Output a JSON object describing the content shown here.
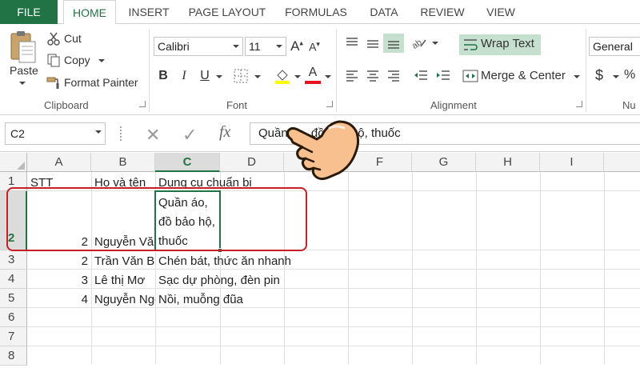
{
  "tabs": [
    {
      "label": "FILE"
    },
    {
      "label": "HOME"
    },
    {
      "label": "INSERT"
    },
    {
      "label": "PAGE LAYOUT"
    },
    {
      "label": "FORMULAS"
    },
    {
      "label": "DATA"
    },
    {
      "label": "REVIEW"
    },
    {
      "label": "VIEW"
    }
  ],
  "clipboard": {
    "paste": "Paste",
    "cut": "Cut",
    "copy": "Copy",
    "format_painter": "Format Painter",
    "group": "Clipboard"
  },
  "font": {
    "name": "Calibri",
    "size": "11",
    "bold": "B",
    "italic": "I",
    "underline": "U",
    "font_color_letter": "A",
    "group": "Font"
  },
  "alignment": {
    "wrap_text": "Wrap Text",
    "merge_center": "Merge & Center",
    "group": "Alignment"
  },
  "number": {
    "format": "General",
    "currency": "$",
    "percent": "%",
    "group": "Nu"
  },
  "formula_bar": {
    "name_box": "C2",
    "fx": "fx",
    "content": "Quần áo, đồ bảo hộ, thuốc"
  },
  "columns": [
    "A",
    "B",
    "C",
    "D",
    "E",
    "F",
    "G",
    "H",
    "I"
  ],
  "rows": [
    "1",
    "2",
    "3",
    "4",
    "5",
    "6",
    "7",
    "8"
  ],
  "cells": {
    "A1": "STT",
    "B1": "Họ và tên",
    "C1": "Dụng cụ chuẩn bị",
    "A2": "2",
    "B2": "Nguyễn Văn A",
    "C2": "Quần áo, đồ bảo hộ, thuốc",
    "A3": "2",
    "B3": "Trần Văn B",
    "C3": "Chén bát, thức ăn nhanh",
    "A4": "3",
    "B4": "Lê thị Mơ",
    "C4": "Sạc dự phòng, đèn pin",
    "A5": "4",
    "B5": "Nguyễn Ngọc",
    "C5": "Nồi, muỗng đũa"
  },
  "colors": {
    "excel_green": "#217346",
    "callout_red": "#c81e25"
  }
}
